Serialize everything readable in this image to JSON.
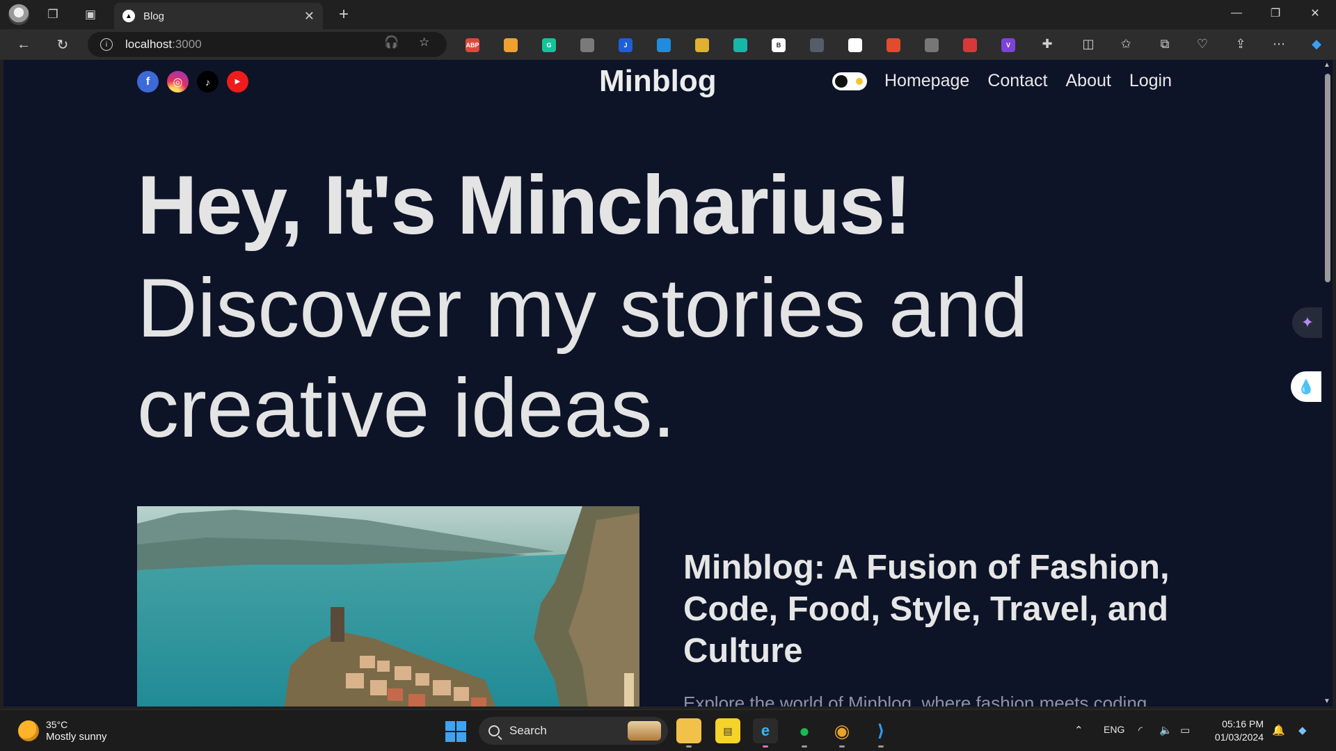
{
  "browser": {
    "tab_title": "Blog",
    "tab_favicon": "▲",
    "url_host": "localhost",
    "url_port": ":3000",
    "extensions": [
      {
        "name": "adblock-plus-icon",
        "label": "ABP",
        "color": "#e2453c"
      },
      {
        "name": "cookie-extension-icon",
        "label": "",
        "color": "#f0a030"
      },
      {
        "name": "grammarly-icon",
        "label": "G",
        "color": "#15c39a"
      },
      {
        "name": "ghostery-icon",
        "label": "",
        "color": "#7a7a7a"
      },
      {
        "name": "jira-extension-icon",
        "label": "J",
        "color": "#1e5ed8"
      },
      {
        "name": "dropper-extension-icon",
        "label": "",
        "color": "#1f8ce0"
      },
      {
        "name": "colorful-extension-icon",
        "label": "",
        "color": "#e0b030"
      },
      {
        "name": "diamond-extension-icon",
        "label": "",
        "color": "#17b6a8"
      },
      {
        "name": "bookmark-b-icon",
        "label": "B",
        "color": "#ffffff"
      },
      {
        "name": "moon-extension-icon",
        "label": "",
        "color": "#555c6a"
      },
      {
        "name": "lens-extension-icon",
        "label": "",
        "color": "#ffffff"
      },
      {
        "name": "chrome-extension-icon",
        "label": "",
        "color": "#e04c2d"
      },
      {
        "name": "compass-extension-icon",
        "label": "",
        "color": "#777777"
      },
      {
        "name": "robot-extension-icon",
        "label": "",
        "color": "#d7383a"
      },
      {
        "name": "v-extension-icon",
        "label": "V",
        "color": "#7d43d8"
      }
    ]
  },
  "page": {
    "logo": "Minblog",
    "nav": [
      "Homepage",
      "Contact",
      "About",
      "Login"
    ],
    "hero_bold": "Hey, It's Mincharius!",
    "hero_light": "Discover my stories and creative ideas.",
    "featured_post": {
      "title": "Minblog: A Fusion of Fashion, Code, Food, Style, Travel, and Culture",
      "description": "Explore the world of Minblog, where fashion meets coding"
    },
    "colors": {
      "background": "#0d1428",
      "text": "#e4e4e4"
    }
  },
  "taskbar": {
    "weather_temp": "35°C",
    "weather_cond": "Mostly sunny",
    "search_label": "Search",
    "language": "ENG",
    "time": "05:16 PM",
    "date": "01/03/2024"
  }
}
